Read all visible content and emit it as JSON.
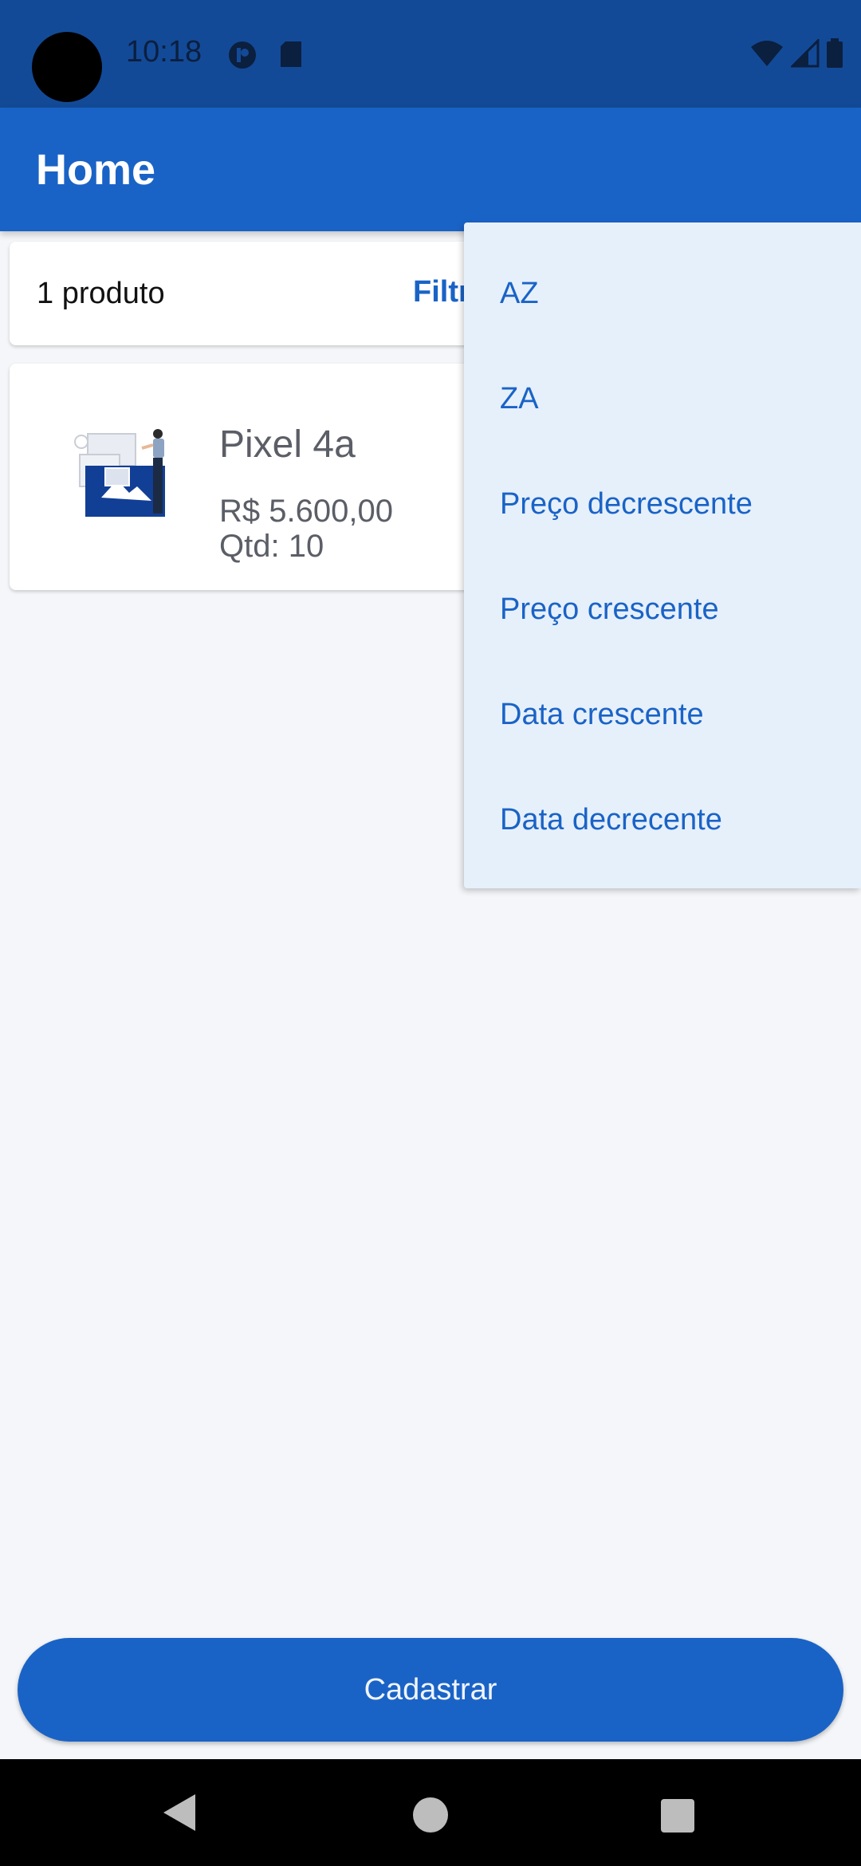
{
  "status_bar": {
    "time": "10:18"
  },
  "app_bar": {
    "title": "Home"
  },
  "filter_row": {
    "count_label": "1 produto",
    "filter_label": "Filtr"
  },
  "product": {
    "name": "Pixel 4a",
    "price": "R$  5.600,00",
    "quantity": "Qtd: 10"
  },
  "dropdown": {
    "items": [
      "AZ",
      "ZA",
      "Preço decrescente",
      "Preço crescente",
      "Data crescente",
      "Data decrecente"
    ]
  },
  "actions": {
    "register_label": "Cadastrar"
  },
  "colors": {
    "primary": "#1a63c6",
    "status_bar": "#134a97",
    "menu_bg": "#e6f0fb",
    "background": "#f4f6f9"
  }
}
